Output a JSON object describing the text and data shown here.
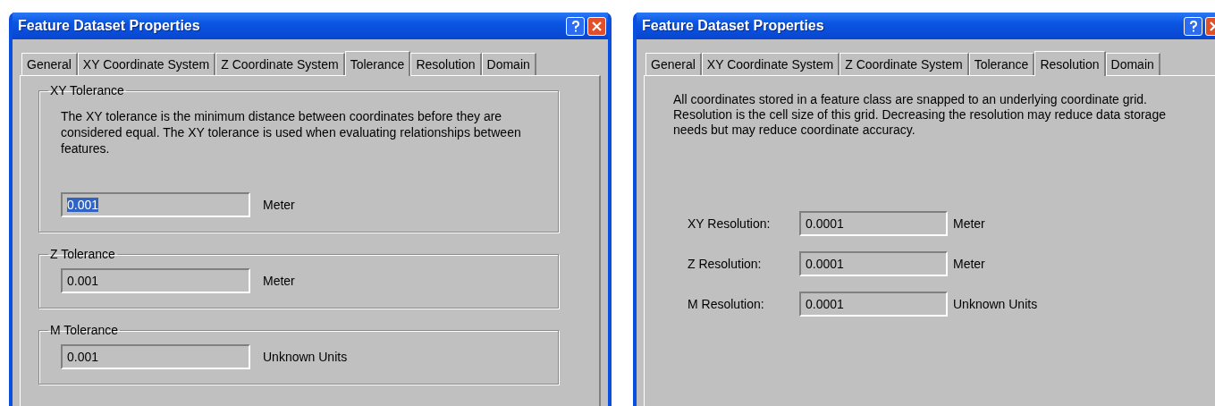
{
  "dialogs": [
    {
      "kind": "tolerance",
      "title": "Feature Dataset Properties",
      "tabs": [
        {
          "label": "General",
          "selected": false
        },
        {
          "label": "XY Coordinate System",
          "selected": false
        },
        {
          "label": "Z Coordinate System",
          "selected": false
        },
        {
          "label": "Tolerance",
          "selected": true
        },
        {
          "label": "Resolution",
          "selected": false
        },
        {
          "label": "Domain",
          "selected": false
        }
      ],
      "groups": [
        {
          "title": "XY Tolerance",
          "description": "The XY tolerance is the minimum distance between coordinates before they are considered equal. The XY tolerance is used when evaluating relationships between features.",
          "value": "0.001",
          "selected": true,
          "unit": "Meter"
        },
        {
          "title": "Z Tolerance",
          "value": "0.001",
          "selected": false,
          "unit": "Meter"
        },
        {
          "title": "M Tolerance",
          "value": "0.001",
          "selected": false,
          "unit": "Unknown Units"
        }
      ]
    },
    {
      "kind": "resolution",
      "title": "Feature Dataset Properties",
      "tabs": [
        {
          "label": "General",
          "selected": false
        },
        {
          "label": "XY Coordinate System",
          "selected": false
        },
        {
          "label": "Z Coordinate System",
          "selected": false
        },
        {
          "label": "Tolerance",
          "selected": false
        },
        {
          "label": "Resolution",
          "selected": true
        },
        {
          "label": "Domain",
          "selected": false
        }
      ],
      "description": "All coordinates stored in a feature class are snapped to an underlying coordinate grid. Resolution is the cell size of this grid. Decreasing the resolution may reduce data storage needs but may reduce coordinate accuracy.",
      "rows": [
        {
          "label": "XY Resolution:",
          "value": "0.0001",
          "unit": "Meter"
        },
        {
          "label": "Z Resolution:",
          "value": "0.0001",
          "unit": "Meter"
        },
        {
          "label": "M Resolution:",
          "value": "0.0001",
          "unit": "Unknown Units"
        }
      ]
    }
  ]
}
